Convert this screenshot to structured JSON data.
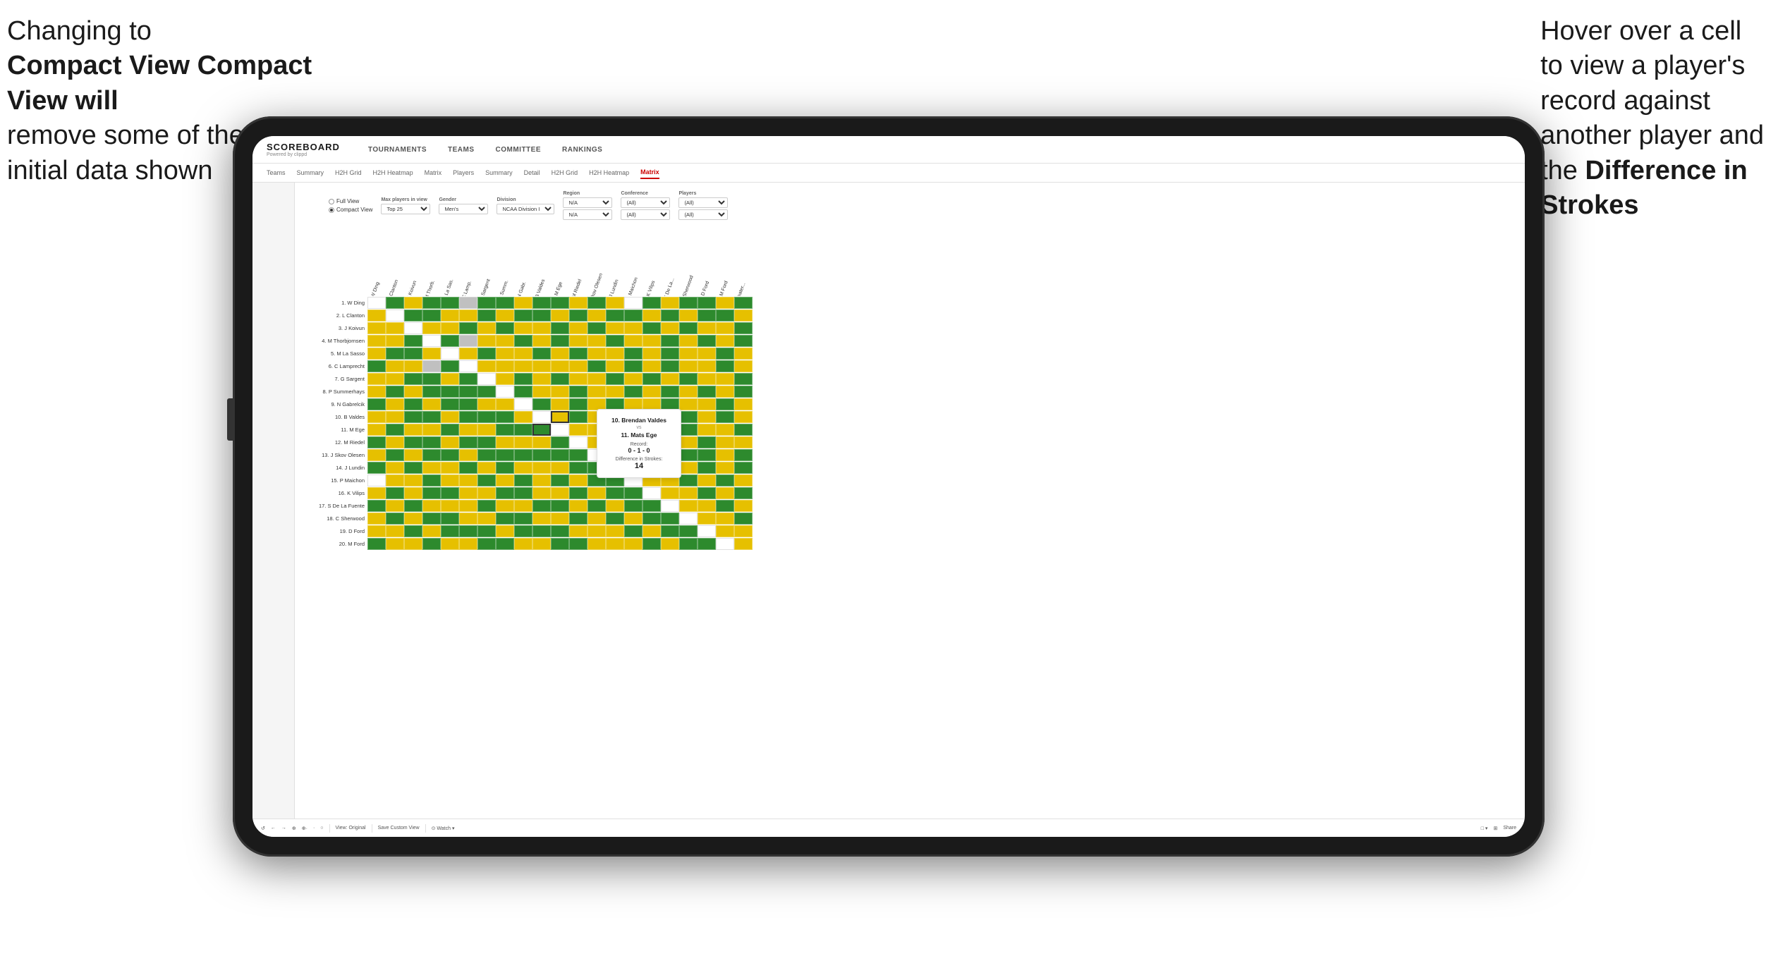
{
  "annotations": {
    "left": {
      "line1": "Changing to",
      "line2": "Compact View will",
      "line3": "remove some of the",
      "line4": "initial data shown"
    },
    "right": {
      "line1": "Hover over a cell",
      "line2": "to view a player's",
      "line3": "record against",
      "line4": "another player and",
      "line5": "the",
      "line6_bold": "Difference in",
      "line7_bold": "Strokes"
    }
  },
  "nav": {
    "logo": "SCOREBOARD",
    "logo_sub": "Powered by clippd",
    "items": [
      "TOURNAMENTS",
      "TEAMS",
      "COMMITTEE",
      "RANKINGS"
    ]
  },
  "tabs": {
    "top_tabs": [
      "Teams",
      "Summary",
      "H2H Grid",
      "H2H Heatmap",
      "Matrix",
      "Players",
      "Summary",
      "Detail",
      "H2H Grid",
      "H2H Heatmap",
      "Matrix"
    ],
    "active_tab": "Matrix"
  },
  "filters": {
    "view_options": [
      "Full View",
      "Compact View"
    ],
    "selected_view": "Compact View",
    "max_players_label": "Max players in view",
    "max_players_value": "Top 25",
    "gender_label": "Gender",
    "gender_value": "Men's",
    "division_label": "Division",
    "division_value": "NCAA Division I",
    "region_label": "Region",
    "region_values": [
      "N/A",
      "N/A"
    ],
    "conference_label": "Conference",
    "conference_values": [
      "(All)",
      "(All)"
    ],
    "players_label": "Players",
    "players_values": [
      "(All)",
      "(All)"
    ]
  },
  "players": [
    "1. W Ding",
    "2. L Clanton",
    "3. J Koivun",
    "4. M Thorbjornsen",
    "5. M La Sasso",
    "6. C Lamprecht",
    "7. G Sargent",
    "8. P Summerhays",
    "9. N Gabrelcik",
    "10. B Valdes",
    "11. M Ege",
    "12. M Riedel",
    "13. J Skov Olesen",
    "14. J Lundin",
    "15. P Maichon",
    "16. K Vilips",
    "17. S De La Fuente",
    "18. C Sherwood",
    "19. D Ford",
    "20. M Ford"
  ],
  "col_headers": [
    "1. W Ding",
    "2. L Clanton",
    "3. J Koivun",
    "4. M Thorb...",
    "5. M La...",
    "6. C Lamp...",
    "7. G Sarg...",
    "8. P Summ...",
    "9. N Gab...",
    "10. B Vald...",
    "11. M Ege",
    "12. M Riedel",
    "13. J Skov Olesen",
    "14. J Lundin",
    "15. P Maichon",
    "16. K Vilips",
    "17. S De La...",
    "18. C Sher...",
    "19. D Ford",
    "20. M Ford",
    "Greater..."
  ],
  "tooltip": {
    "player1": "10. Brendan Valdes",
    "vs": "vs",
    "player2": "11. Mats Ege",
    "record_label": "Record:",
    "record": "0 - 1 - 0",
    "diff_label": "Difference in Strokes:",
    "diff": "14"
  },
  "toolbar": {
    "buttons": [
      "↺",
      "←",
      "→",
      "⊕",
      "⊕ ·",
      "·",
      "○",
      "View: Original",
      "Save Custom View",
      "⊙ Watch ▾",
      "□ ▾",
      "⊞",
      "Share"
    ]
  }
}
